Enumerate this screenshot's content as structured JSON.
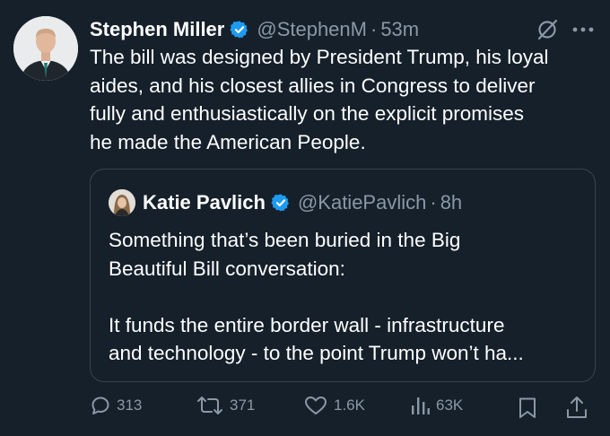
{
  "tweet": {
    "author_name": "Stephen Miller",
    "handle": "@StephenM",
    "separator": "·",
    "time": "53m",
    "text": "The bill was designed by President Trump, his loyal\naides, and his closest allies in Congress to deliver\nfully and enthusiastically on the explicit promises\nhe made the American People."
  },
  "quote": {
    "author_name": "Katie Pavlich",
    "handle": "@KatiePavlich",
    "separator": "·",
    "time": "8h",
    "text": "Something that’s been buried in the Big\nBeautiful Bill conversation:\n\nIt funds the entire border wall - infrastructure\nand technology - to the point Trump won’t ha..."
  },
  "actions": {
    "replies": "313",
    "reposts": "371",
    "likes": "1.6K",
    "views": "63K"
  },
  "icons": {
    "verified": "verified-badge-icon",
    "grok": "grok-icon",
    "more": "more-icon",
    "reply": "reply-icon",
    "repost": "repost-icon",
    "like": "heart-icon",
    "views": "views-chart-icon",
    "bookmark": "bookmark-icon",
    "share": "share-icon"
  },
  "colors": {
    "background": "#15202b",
    "text": "#ffffff",
    "muted": "#8b98a5",
    "verified": "#1d9bf0",
    "border": "#38444d"
  }
}
